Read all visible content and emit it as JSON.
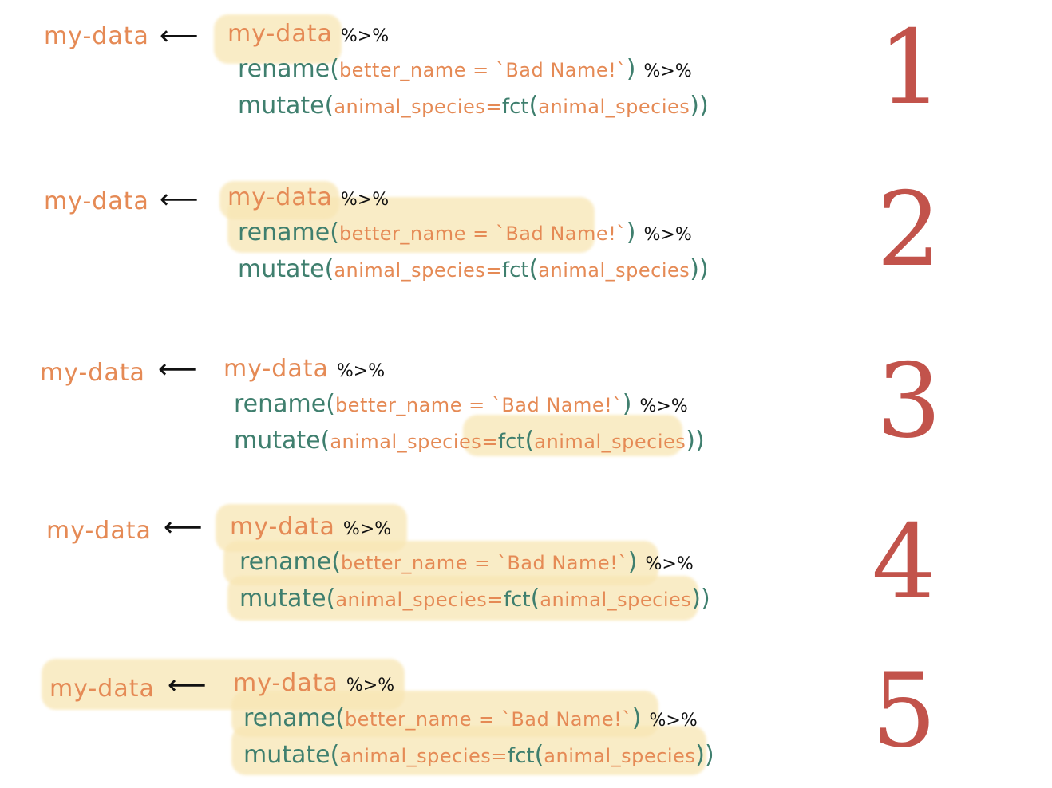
{
  "code": {
    "target": "my-data",
    "arrow": "⟵",
    "source": "my-data",
    "pipe": "%>%",
    "rename_fn": "rename",
    "rename_args": "better_name = `Bad Name!`",
    "mutate_fn": "mutate",
    "mutate_lhs": "animal_species",
    "mutate_eq": "=",
    "fct_fn": "fct",
    "mutate_inner": "animal_species",
    "open_paren": "(",
    "close_paren": ")",
    "close_double": "))"
  },
  "steps": [
    {
      "number": "1"
    },
    {
      "number": "2"
    },
    {
      "number": "3"
    },
    {
      "number": "4"
    },
    {
      "number": "5"
    }
  ],
  "colors": {
    "orange": "#e58a55",
    "green": "#3f7f6e",
    "red": "#c2534b",
    "highlight": "#f8e6b4"
  }
}
